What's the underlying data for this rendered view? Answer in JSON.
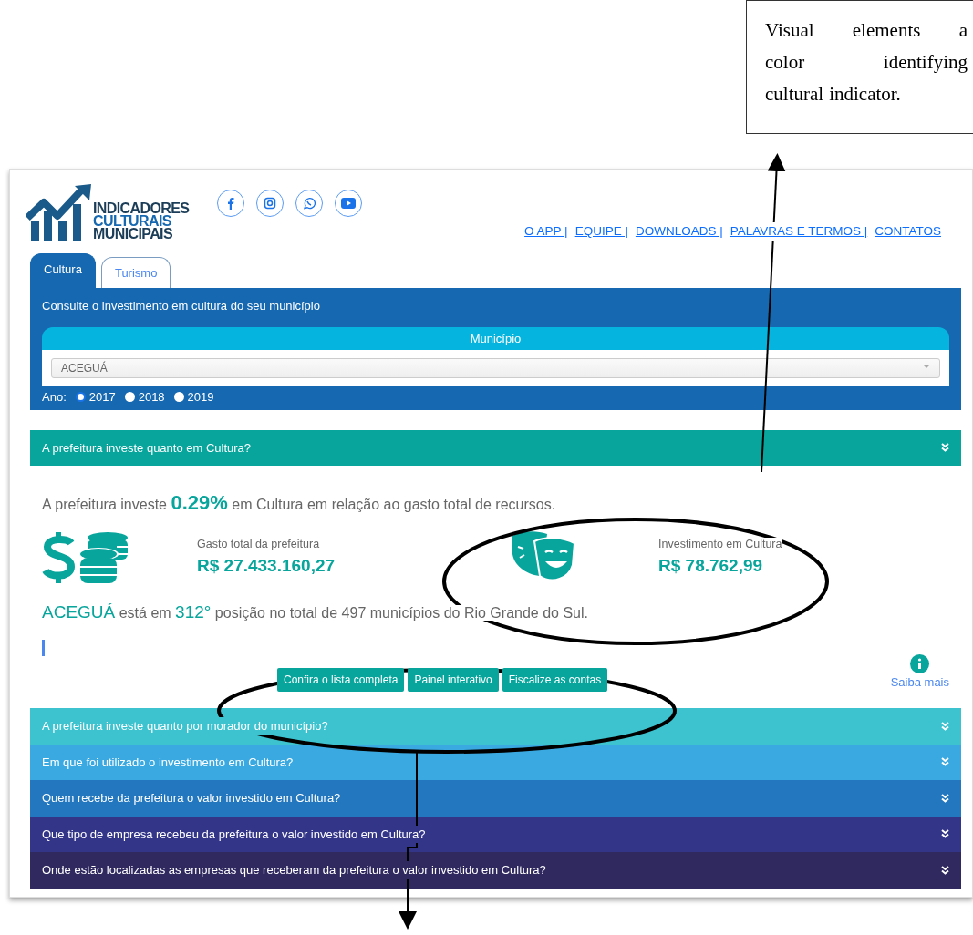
{
  "annotation": {
    "lines": [
      "Visual elements a",
      "color identifying",
      "cultural indicator."
    ]
  },
  "logo": {
    "lines": [
      "INDICADORES",
      "CULTURAIS",
      "MUNICIPAIS"
    ]
  },
  "nav": [
    "O APP |",
    "EQUIPE |",
    "DOWNLOADS |",
    "PALAVRAS E TERMOS |",
    "CONTATOS"
  ],
  "tabs": [
    {
      "label": "Cultura",
      "selected": true
    },
    {
      "label": "Turismo",
      "selected": false
    }
  ],
  "search_panel": {
    "title": "Consulte o investimento em cultura do seu município",
    "select_header": "Município",
    "select_value": "ACEGUÁ",
    "year_label": "Ano:",
    "years": [
      {
        "label": "2017",
        "selected": true
      },
      {
        "label": "2018",
        "selected": false
      },
      {
        "label": "2019",
        "selected": false
      }
    ]
  },
  "sections": [
    {
      "title": "A prefeitura investe quanto em Cultura?",
      "color": "#07a59c",
      "expanded": true,
      "content": {
        "summary": {
          "before": "A prefeitura investe",
          "highlight": "0.29%",
          "after": "em Cultura em relação ao gasto total de recursos."
        },
        "stats": [
          {
            "kind": "coins",
            "label": "Gasto total da prefeitura",
            "value": "R$ 27.433.160,27"
          },
          {
            "kind": "masks",
            "label": "Investimento em Cultura",
            "value": "R$ 78.762,99"
          }
        ],
        "ranking": {
          "municipality": "ACEGUÁ",
          "middle": "está em",
          "position": "312°",
          "rest": "posição no total de 497 municípios do Rio Grande do Sul."
        },
        "buttons": [
          "Confira o lista completa",
          "Painel interativo",
          "Fiscalize as contas"
        ],
        "info_link": "Saiba mais"
      }
    },
    {
      "title": "A prefeitura investe quanto por morador do município?",
      "color": "#3cc3cf",
      "expanded": false
    },
    {
      "title": "Em que foi utilizado o investimento em Cultura?",
      "color": "#3aa9e1",
      "expanded": false
    },
    {
      "title": "Quem recebe da prefeitura o valor investido em Cultura?",
      "color": "#2277bf",
      "expanded": false
    },
    {
      "title": "Que tipo de empresa recebeu da prefeitura o valor investido em Cultura?",
      "color": "#333588",
      "expanded": false
    },
    {
      "title": "Onde estão localizadas as empresas que receberam da prefeitura o valor investido em Cultura?",
      "color": "#2f2960",
      "expanded": false
    }
  ]
}
